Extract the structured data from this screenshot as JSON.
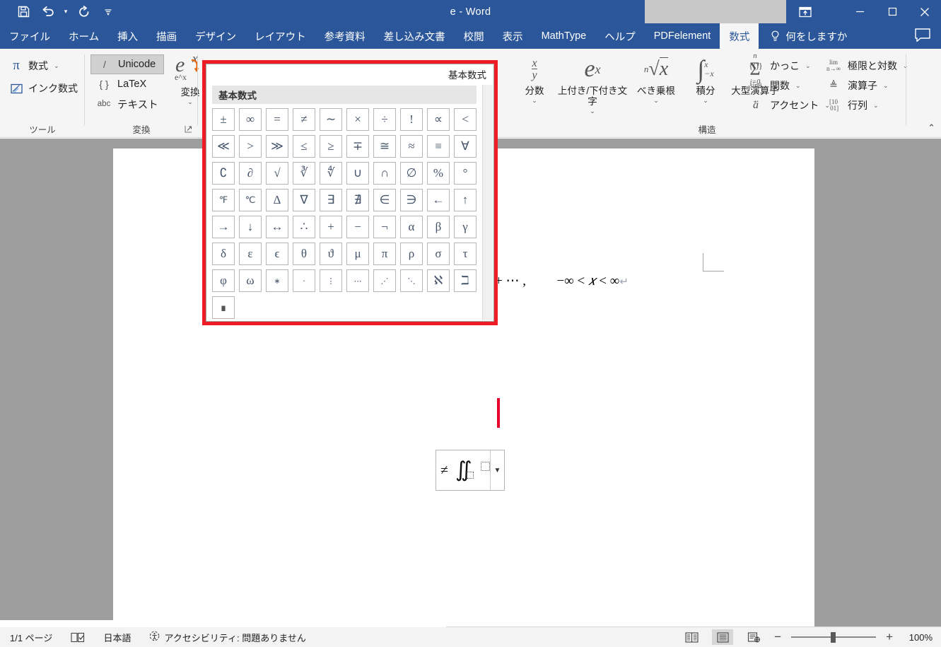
{
  "window": {
    "title": "e  -  Word",
    "qat": [
      {
        "name": "save",
        "label": "保存"
      },
      {
        "name": "undo",
        "label": "元に戻す"
      },
      {
        "name": "redo",
        "label": "やり直し"
      },
      {
        "name": "customize-qat",
        "label": "クイック アクセス ツール バーのユーザー設定"
      }
    ],
    "ribbon_display_options": "リボンの表示オプション",
    "minimize": "最小化",
    "maximize": "最大化",
    "close": "閉じる"
  },
  "tabs": [
    {
      "label": "ファイル",
      "active": false
    },
    {
      "label": "ホーム",
      "active": false
    },
    {
      "label": "挿入",
      "active": false
    },
    {
      "label": "描画",
      "active": false
    },
    {
      "label": "デザイン",
      "active": false
    },
    {
      "label": "レイアウト",
      "active": false
    },
    {
      "label": "参考資料",
      "active": false
    },
    {
      "label": "差し込み文書",
      "active": false
    },
    {
      "label": "校閲",
      "active": false
    },
    {
      "label": "表示",
      "active": false
    },
    {
      "label": "MathType",
      "active": false
    },
    {
      "label": "ヘルプ",
      "active": false
    },
    {
      "label": "PDFelement",
      "active": false
    },
    {
      "label": "数式",
      "active": true
    }
  ],
  "tell_me": "何をしますか",
  "ribbon": {
    "groups": [
      {
        "name": "tools",
        "label": "ツール"
      },
      {
        "name": "conversion",
        "label": "変換"
      },
      {
        "name": "structure",
        "label": "構造"
      }
    ],
    "tools": [
      {
        "name": "equation",
        "label": "数式",
        "icon": "pi-icon",
        "has_dropdown": true
      },
      {
        "name": "ink-equation",
        "label": "インク数式",
        "icon": "ink-icon",
        "has_dropdown": false
      }
    ],
    "conversion": {
      "options": [
        {
          "name": "unicode",
          "key": "/",
          "label": "Unicode",
          "selected": true
        },
        {
          "name": "latex",
          "key": "{ }",
          "label": "LaTeX",
          "selected": false
        },
        {
          "name": "text",
          "key": "abc",
          "label": "テキスト",
          "selected": false
        }
      ],
      "convert_button": {
        "label": "変換",
        "glyph_top": "e",
        "glyph_sup": "x",
        "glyph_bottom": "e^x",
        "has_dropdown": true
      },
      "dialog_launcher": "変換の設定"
    },
    "structure_big": [
      {
        "name": "fraction",
        "label": "分数",
        "glyph": "x/y",
        "has_dropdown": true
      },
      {
        "name": "script",
        "label": "上付き/下付き文字",
        "glyph": "e^x",
        "has_dropdown": true
      },
      {
        "name": "radical",
        "label": "べき乗根",
        "glyph": "n√x",
        "has_dropdown": true
      },
      {
        "name": "integral",
        "label": "積分",
        "glyph": "∫",
        "has_dropdown": true
      },
      {
        "name": "large-operator",
        "label": "大型演算子",
        "glyph": "Σ",
        "has_dropdown": true
      }
    ],
    "structure_small": [
      {
        "name": "bracket",
        "label": "かっこ",
        "glyph": "{()}",
        "has_dropdown": true
      },
      {
        "name": "function",
        "label": "関数",
        "glyph": "sinθ",
        "has_dropdown": true
      },
      {
        "name": "accent",
        "label": "アクセント",
        "glyph": "ä",
        "has_dropdown": true
      },
      {
        "name": "limit-log",
        "label": "極限と対数",
        "glyph": "lim",
        "has_dropdown": true
      },
      {
        "name": "operator",
        "label": "演算子",
        "glyph": "△",
        "has_dropdown": true
      },
      {
        "name": "matrix",
        "label": "行列",
        "glyph": "[10/01]",
        "has_dropdown": true
      }
    ],
    "collapse_ribbon": "リボンを折りたたむ"
  },
  "gallery": {
    "header_label": "基本数式",
    "section_label": "基本数式",
    "symbols": [
      "±",
      "∞",
      "=",
      "≠",
      "∼",
      "×",
      "÷",
      "!",
      "∝",
      "<",
      "≪",
      ">",
      "≫",
      "≤",
      "≥",
      "∓",
      "≅",
      "≈",
      "≡",
      "∀",
      "∁",
      "∂",
      "√",
      "∛",
      "∜",
      "∪",
      "∩",
      "∅",
      "%",
      "°",
      "℉",
      "℃",
      "Δ",
      "∇",
      "∃",
      "∄",
      "∈",
      "∋",
      "←",
      "↑",
      "→",
      "↓",
      "↔",
      "∴",
      "+",
      "−",
      "¬",
      "α",
      "β",
      "γ",
      "δ",
      "ε",
      "ϵ",
      "θ",
      "ϑ",
      "μ",
      "π",
      "ρ",
      "σ",
      "τ",
      "φ",
      "ω",
      "∗",
      "⋅",
      "⋮",
      "⋯",
      "⋰",
      "⋱",
      "ℵ",
      "ℶ",
      "∎"
    ]
  },
  "document": {
    "equation_text": "+ ⋯ ,",
    "equation_range_pre": "−∞ <",
    "equation_range_var": "𝑥",
    "equation_range_post": "< ∞",
    "paragraph_mark": "↵"
  },
  "mini_toolbar": {
    "items": [
      {
        "name": "not-equal",
        "glyph": "≠"
      },
      {
        "name": "double-integral",
        "glyph": "∬"
      },
      {
        "name": "placeholder-box",
        "glyph": "□"
      }
    ],
    "dropdown": "その他"
  },
  "statusbar": {
    "page": "1/1 ページ",
    "proofing": "校正記号",
    "language": "日本語",
    "accessibility": "アクセシビリティ: 問題ありません",
    "views": [
      {
        "name": "read-mode",
        "label": "閲覧モード",
        "selected": false
      },
      {
        "name": "print-layout",
        "label": "印刷レイアウト",
        "selected": true
      },
      {
        "name": "web-layout",
        "label": "Web レイアウト",
        "selected": false
      }
    ],
    "zoom_out": "縮小",
    "zoom_in": "拡大",
    "zoom_value": "100%"
  },
  "colors": {
    "titlebar": "#2b579a",
    "ribbon_bg": "#f5f5f5",
    "annotation_red": "#ee1c25",
    "symbol_blue": "#44546a",
    "doc_bg": "#9e9e9e"
  }
}
